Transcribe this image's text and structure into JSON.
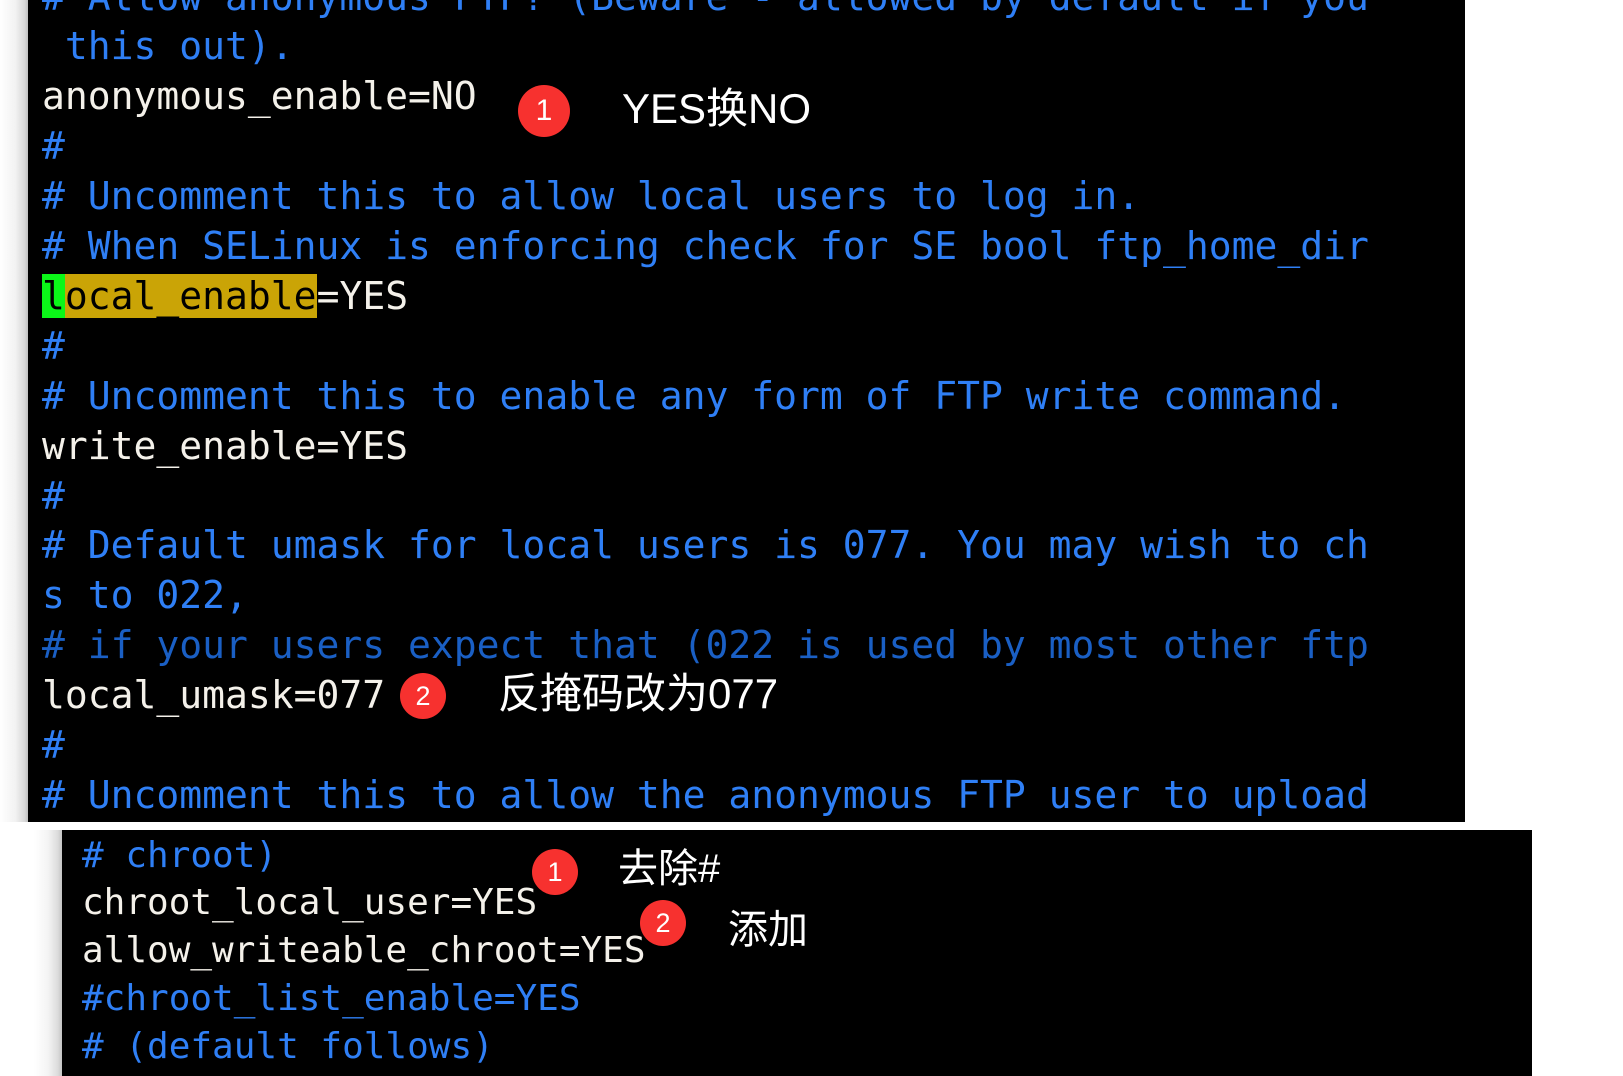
{
  "panels": {
    "top": {
      "name": "vsftpd-config-top",
      "lines": [
        {
          "text": "# Allow anonymous FTP? (Beware - allowed by default if you",
          "kind": "comment",
          "clipped_top": true
        },
        {
          "text": " this out).",
          "kind": "comment"
        },
        {
          "text": "anonymous_enable=NO",
          "kind": "config"
        },
        {
          "text": "#",
          "kind": "comment"
        },
        {
          "text": "# Uncomment this to allow local users to log in.",
          "kind": "comment"
        },
        {
          "text": "# When SELinux is enforcing check for SE bool ftp_home_dir",
          "kind": "comment"
        },
        {
          "text": "local_enable=YES",
          "kind": "config",
          "highlight": {
            "cursor": "l",
            "match": "ocal_enable",
            "rest": "=YES"
          }
        },
        {
          "text": "#",
          "kind": "comment"
        },
        {
          "text": "# Uncomment this to enable any form of FTP write command.",
          "kind": "comment"
        },
        {
          "text": "write_enable=YES",
          "kind": "config"
        },
        {
          "text": "#",
          "kind": "comment"
        },
        {
          "text": "# Default umask for local users is 077. You may wish to ch",
          "kind": "comment"
        },
        {
          "text": "s to 022,",
          "kind": "comment"
        },
        {
          "text": "# if your users expect that (022 is used by most other ftp",
          "kind": "comment"
        },
        {
          "text": "local_umask=077",
          "kind": "config"
        },
        {
          "text": "#",
          "kind": "comment"
        },
        {
          "text": "# Uncomment this to allow the anonymous FTP user to upload",
          "kind": "comment",
          "clipped_bottom": true
        }
      ],
      "annotations": [
        {
          "badge": "1",
          "label": "YES换NO"
        },
        {
          "badge": "2",
          "label": "反掩码改为077"
        }
      ]
    },
    "bottom": {
      "name": "vsftpd-config-bottom",
      "lines": [
        {
          "text": "# chroot)",
          "kind": "comment"
        },
        {
          "text": "chroot_local_user=YES",
          "kind": "config"
        },
        {
          "text": "allow_writeable_chroot=YES",
          "kind": "config"
        },
        {
          "text": "#chroot_list_enable=YES",
          "kind": "comment"
        },
        {
          "text": "# (default follows)",
          "kind": "comment",
          "clipped_bottom": true
        }
      ],
      "annotations": [
        {
          "badge": "1",
          "label": "去除#"
        },
        {
          "badge": "2",
          "label": "添加"
        }
      ]
    }
  },
  "colors": {
    "terminal_bg": "#000000",
    "comment_blue": "#2f7ff5",
    "config_white": "#f4f1ea",
    "badge_red": "#f7312f",
    "cursor_green": "#0bf718",
    "search_highlight": "#caa406",
    "annotation_text": "#ffffff"
  }
}
